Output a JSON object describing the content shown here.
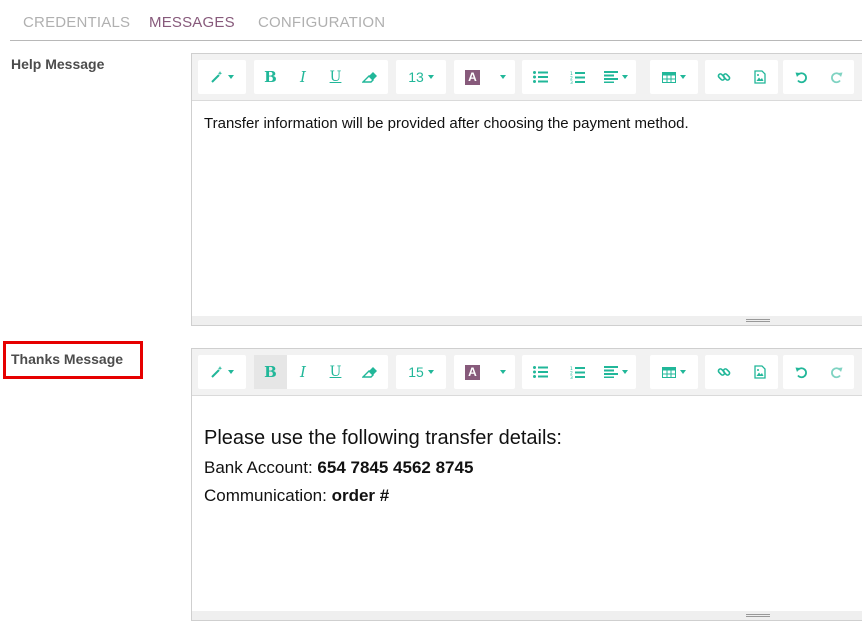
{
  "tabs": [
    {
      "label": "CREDENTIALS",
      "active": false
    },
    {
      "label": "MESSAGES",
      "active": true
    },
    {
      "label": "CONFIGURATION",
      "active": false
    }
  ],
  "help": {
    "label": "Help Message",
    "font_size": "13",
    "content": "Transfer information will be provided after choosing the payment method."
  },
  "thanks": {
    "label": "Thanks Message",
    "font_size": "15",
    "heading": "Please use the following transfer details:",
    "bank_label": "Bank Account: ",
    "bank_value": "654 7845 4562 8745",
    "comm_label": "Communication: ",
    "comm_value": "order #"
  },
  "toolbar": {
    "bold": "B",
    "italic": "I",
    "underline": "U",
    "color_glyph": "A",
    "icons": [
      "magic-wand-icon",
      "eraser-icon",
      "bulleted-list-icon",
      "numbered-list-icon",
      "align-icon",
      "table-icon",
      "link-icon",
      "image-icon",
      "undo-icon",
      "redo-icon"
    ]
  },
  "colors": {
    "accent": "#21b799",
    "brand": "#875a7b",
    "highlight": "#e60000"
  }
}
